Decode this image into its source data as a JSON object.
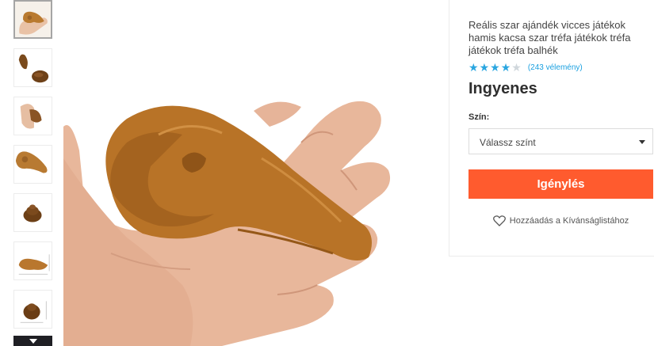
{
  "thumbnails": [
    {
      "name": "thumbnail-1-hand-holding"
    },
    {
      "name": "thumbnail-2-two-pieces"
    },
    {
      "name": "thumbnail-3-hand-small"
    },
    {
      "name": "thumbnail-4-coiled-side"
    },
    {
      "name": "thumbnail-5-pile"
    },
    {
      "name": "thumbnail-6-dimensions-flat"
    },
    {
      "name": "thumbnail-7-dimensions-pile"
    }
  ],
  "product": {
    "title": "Reális szar ajándék vicces játékok hamis kacsa szar tréfa játékok tréfa játékok tréfa balhék",
    "rating_stars": 4,
    "rating_max": 5,
    "review_count": "(243 vélemény)",
    "price": "Ingyenes",
    "color_label": "Szín:",
    "color_select_value": "Válassz színt",
    "claim_button": "Igénylés",
    "wishlist_label": "Hozzáadás a Kívánságlistához"
  },
  "colors": {
    "accent": "#ff5b2e",
    "star_filled": "#2aa6e0",
    "star_empty": "#d0d7dc",
    "link": "#1aa0e0"
  }
}
